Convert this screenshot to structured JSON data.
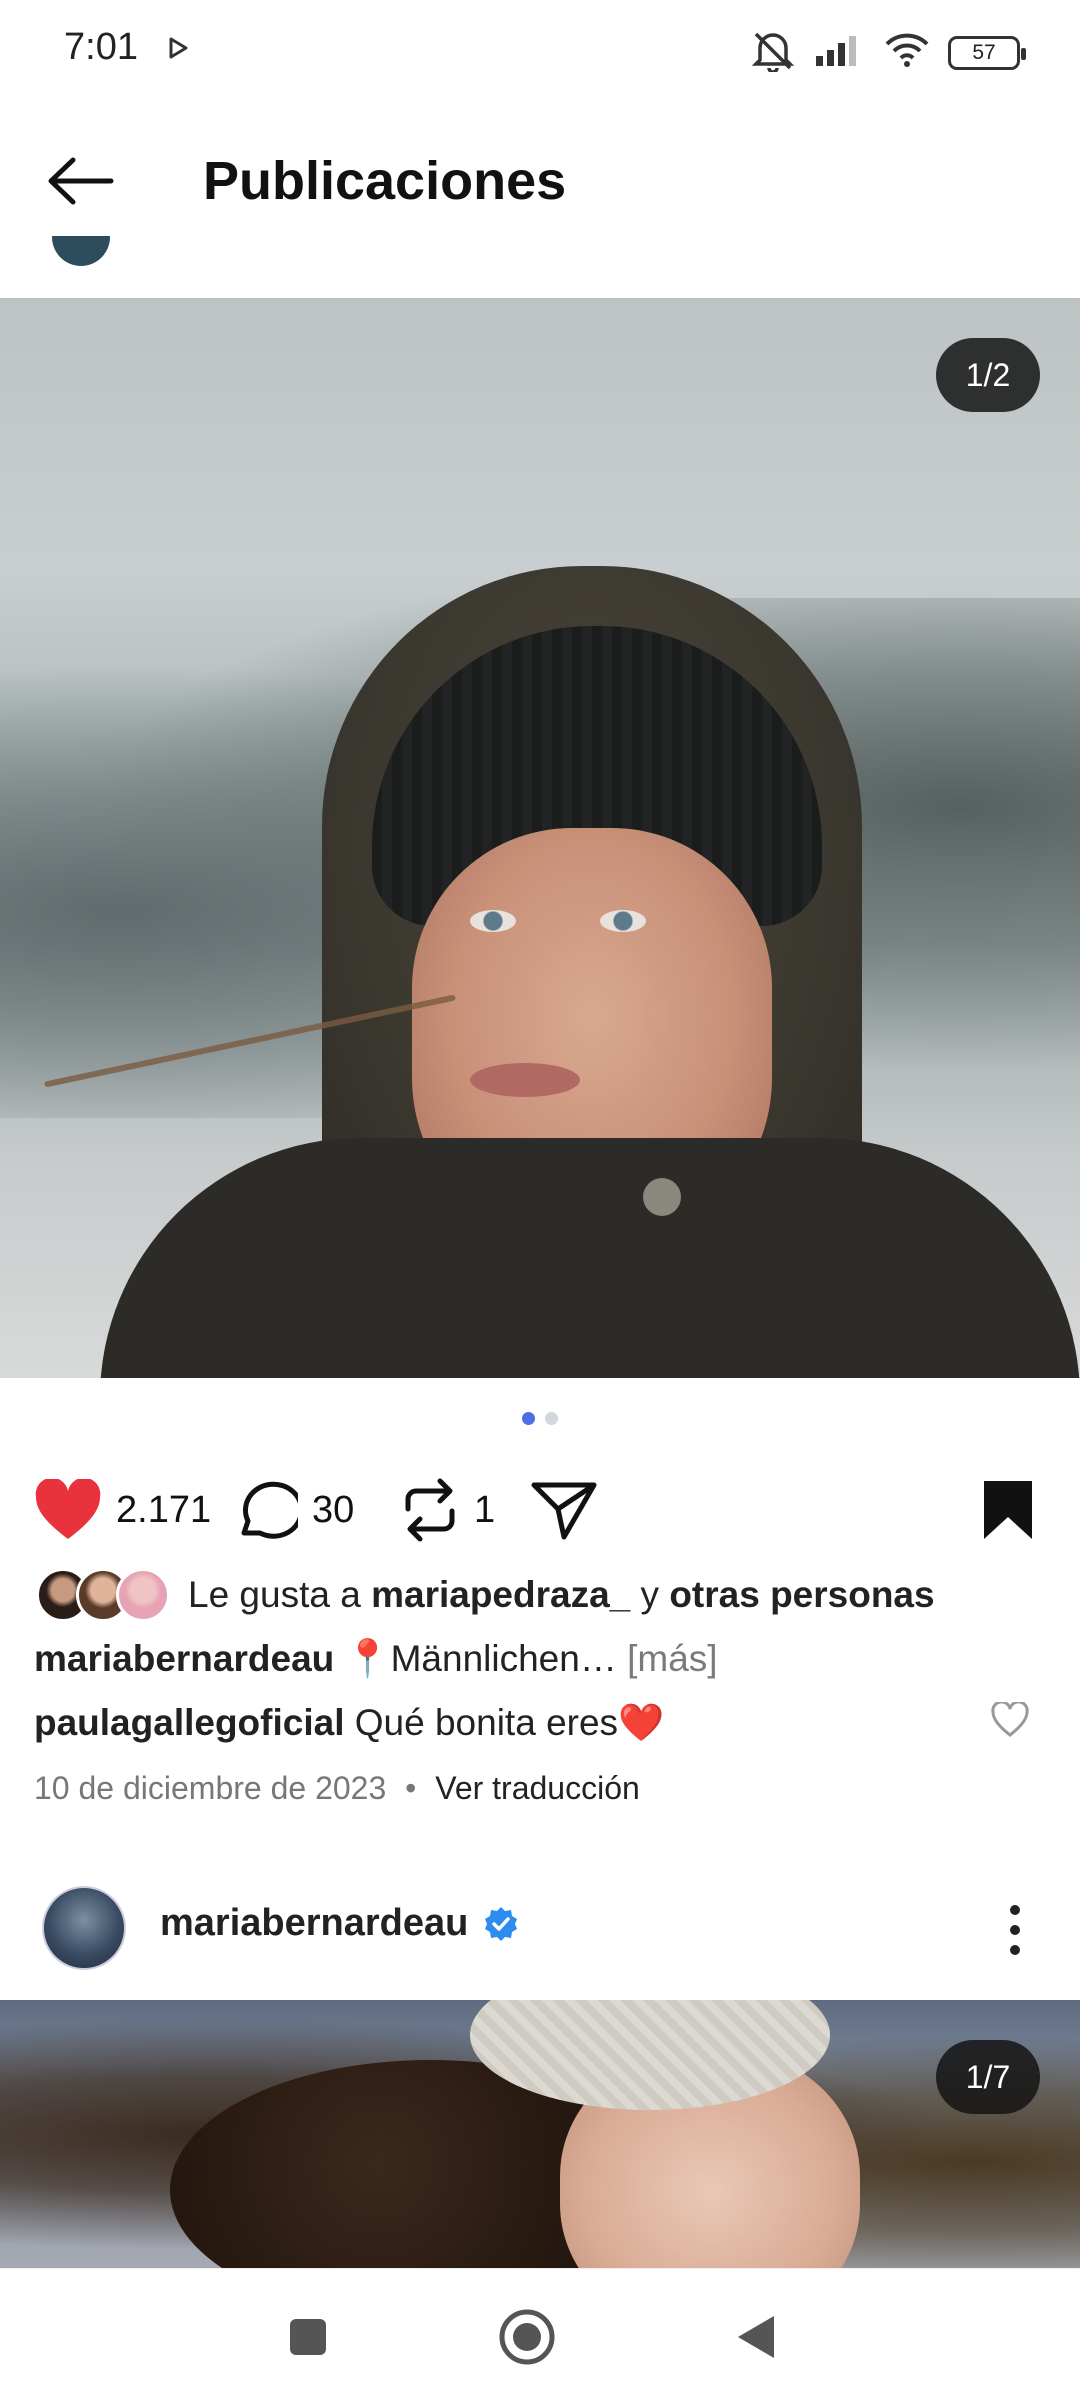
{
  "status_bar": {
    "time": "7:01",
    "battery": "57",
    "icons": [
      "play-icon",
      "mute-icon",
      "signal-icon",
      "wifi-icon",
      "battery-icon"
    ]
  },
  "header": {
    "title": "Publicaciones",
    "back_icon": "arrow-left-icon"
  },
  "post": {
    "image_counter": "1/2",
    "carousel_dots": 2,
    "carousel_active": 0,
    "likes_count": "2.171",
    "comments_count": "30",
    "reposts_count": "1",
    "liked": true,
    "saved": true,
    "liked_by": {
      "prefix": "Le gusta a",
      "user": "mariapedraza_",
      "conj": "y",
      "others": "otras personas"
    },
    "caption": {
      "user": "mariabernardeau",
      "text": "📍Männlichen…",
      "more": "[más]"
    },
    "top_comment": {
      "user": "paulagallegoficial",
      "text": "Qué bonita eres❤️"
    },
    "date": "10 de diciembre de 2023",
    "separator": "•",
    "translate": "Ver traducción"
  },
  "next_post": {
    "user": "mariabernardeau",
    "verified": true,
    "image_counter": "1/7"
  },
  "colors": {
    "heart": "#e8323c",
    "verified": "#2d8cf0",
    "active_dot": "#4e6de6"
  }
}
